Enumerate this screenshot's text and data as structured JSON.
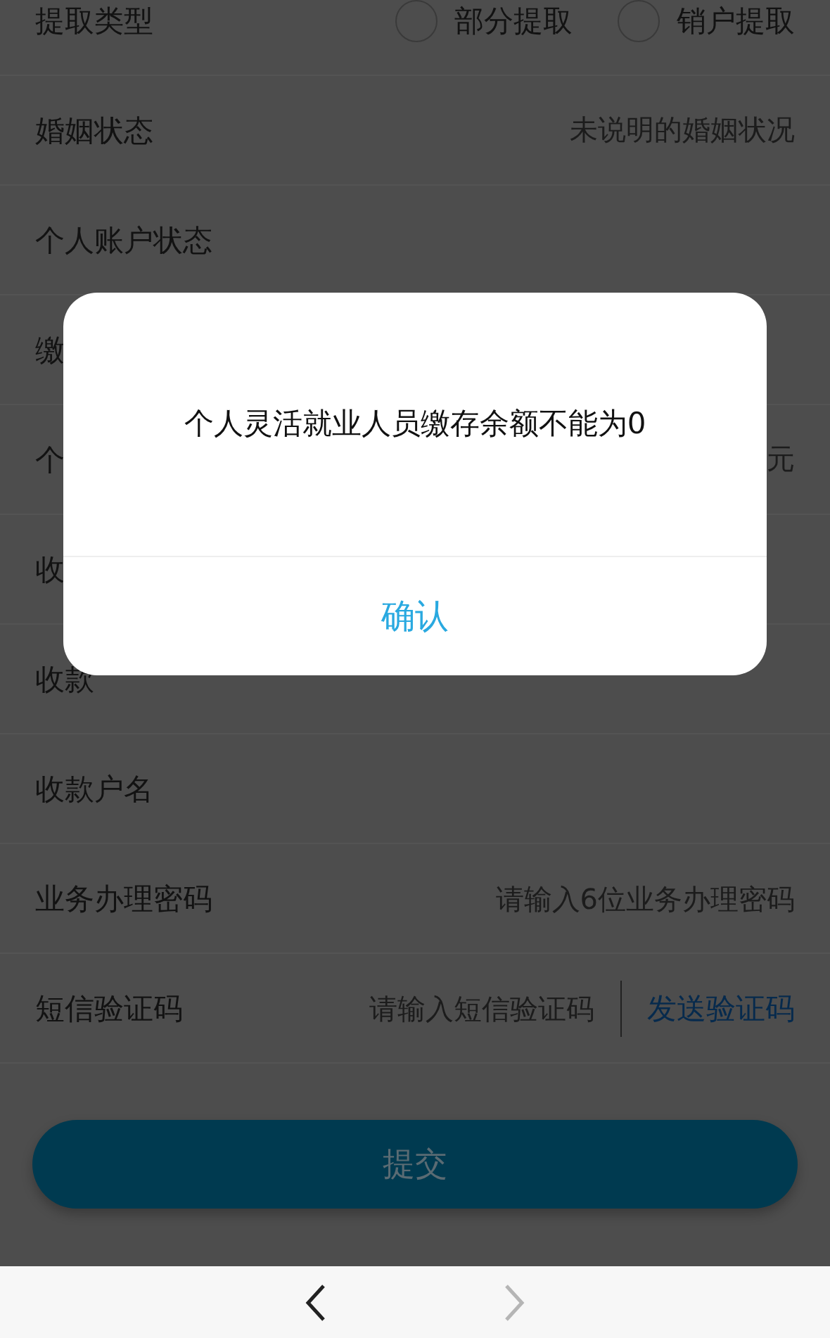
{
  "form_rows": [
    {
      "kind": "radio",
      "label": "提取类型",
      "options": [
        {
          "label": "部分提取",
          "selected": false
        },
        {
          "label": "销户提取",
          "selected": false
        }
      ]
    },
    {
      "kind": "value",
      "label": "婚姻状态",
      "value": "未说明的婚姻状况"
    },
    {
      "kind": "value",
      "label": "个人账户状态"
    },
    {
      "kind": "value",
      "label": "缴"
    },
    {
      "kind": "value",
      "label": "个",
      "value": "元"
    },
    {
      "kind": "value",
      "label": "收"
    },
    {
      "kind": "value",
      "label": "收款"
    },
    {
      "kind": "value",
      "label": "收款户名"
    },
    {
      "kind": "input",
      "label": "业务办理密码",
      "placeholder": "请输入6位业务办理密码"
    },
    {
      "kind": "sms",
      "label": "短信验证码",
      "placeholder": "请输入短信验证码",
      "action": "发送验证码"
    }
  ],
  "submit_button": "提交",
  "dialog": {
    "message": "个人灵活就业人员缴存余额不能为0",
    "confirm": "确认"
  },
  "nav_bar": {
    "back_disabled": false,
    "forward_disabled": true
  }
}
